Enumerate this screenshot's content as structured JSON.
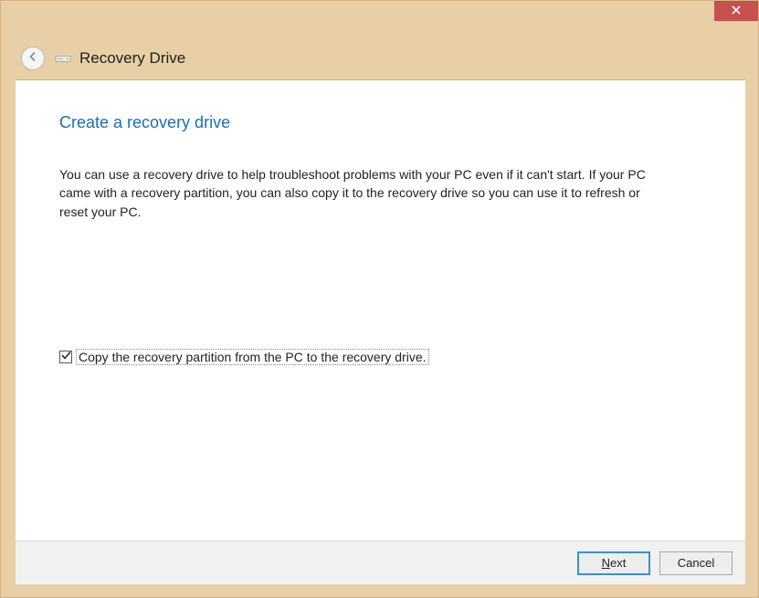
{
  "header": {
    "title": "Recovery Drive"
  },
  "page": {
    "heading": "Create a recovery drive",
    "body": "You can use a recovery drive to help troubleshoot problems with your PC even if it can't start. If your PC came with a recovery partition, you can also copy it to the recovery drive so you can use it to refresh or reset your PC."
  },
  "checkbox": {
    "label": "Copy the recovery partition from the PC to the recovery drive.",
    "checked": true
  },
  "buttons": {
    "next_prefix": "N",
    "next_suffix": "ext",
    "cancel": "Cancel"
  },
  "colors": {
    "accent": "#1a6fb5",
    "frame": "#e8cfa5",
    "close": "#c8504e"
  }
}
